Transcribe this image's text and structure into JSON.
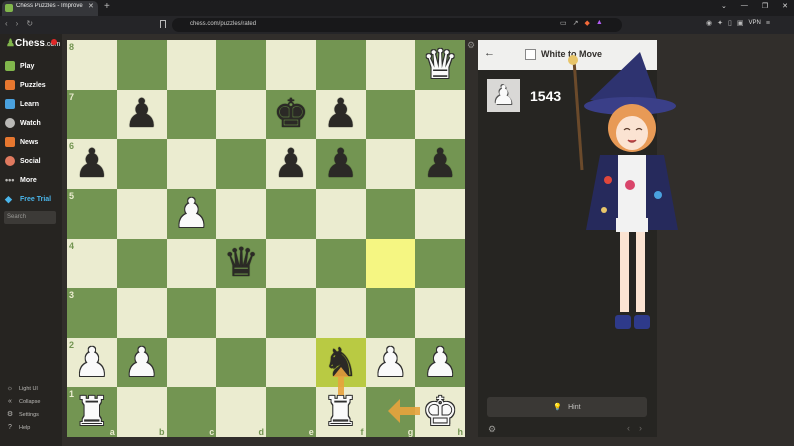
{
  "browser": {
    "tab_title": "Chess Puzzles - Improve Your C",
    "tab_close": "✕",
    "new_tab": "+",
    "url": "chess.com/puzzles/rated",
    "vpn_label": "VPN",
    "window_controls": [
      "⌄",
      "—",
      "❐",
      "✕"
    ]
  },
  "sidebar": {
    "logo": "Chess",
    "logo_suffix": ".com",
    "items": [
      {
        "label": "Play",
        "icon": "play-icon",
        "color": "#81b64c"
      },
      {
        "label": "Puzzles",
        "icon": "puzzle-icon",
        "color": "#e7772f"
      },
      {
        "label": "Learn",
        "icon": "learn-icon",
        "color": "#4aa1de"
      },
      {
        "label": "Watch",
        "icon": "watch-icon",
        "color": "#bab9b6"
      },
      {
        "label": "News",
        "icon": "news-icon",
        "color": "#e7772f"
      },
      {
        "label": "Social",
        "icon": "social-icon",
        "color": "#e07a5f"
      },
      {
        "label": "More",
        "icon": "more-icon",
        "color": "#bab9b6"
      },
      {
        "label": "Free Trial",
        "icon": "diamond-icon",
        "color": "#4ab5ea"
      }
    ],
    "search_placeholder": "Search",
    "bottom": [
      {
        "label": "Light UI",
        "icon": "sun-icon"
      },
      {
        "label": "Collapse",
        "icon": "collapse-icon"
      },
      {
        "label": "Settings",
        "icon": "gear-icon"
      },
      {
        "label": "Help",
        "icon": "help-icon"
      }
    ]
  },
  "board": {
    "ranks": [
      "8",
      "7",
      "6",
      "5",
      "4",
      "3",
      "2",
      "1"
    ],
    "files": [
      "a",
      "b",
      "c",
      "d",
      "e",
      "f",
      "g",
      "h"
    ],
    "light_color": "#ebecd0",
    "dark_color": "#739552",
    "highlighted": [
      "g4",
      "f2"
    ],
    "pieces": [
      {
        "sq": "h8",
        "piece": "queen",
        "color": "white",
        "glyph": "♛"
      },
      {
        "sq": "b7",
        "piece": "pawn",
        "color": "black",
        "glyph": "♟"
      },
      {
        "sq": "e7",
        "piece": "king",
        "color": "black",
        "glyph": "♚"
      },
      {
        "sq": "f7",
        "piece": "pawn",
        "color": "black",
        "glyph": "♟"
      },
      {
        "sq": "a6",
        "piece": "pawn",
        "color": "black",
        "glyph": "♟"
      },
      {
        "sq": "e6",
        "piece": "pawn",
        "color": "black",
        "glyph": "♟"
      },
      {
        "sq": "f6",
        "piece": "pawn",
        "color": "black",
        "glyph": "♟"
      },
      {
        "sq": "h6",
        "piece": "pawn",
        "color": "black",
        "glyph": "♟"
      },
      {
        "sq": "c5",
        "piece": "pawn",
        "color": "white",
        "glyph": "♟"
      },
      {
        "sq": "d4",
        "piece": "queen",
        "color": "black",
        "glyph": "♛"
      },
      {
        "sq": "a2",
        "piece": "pawn",
        "color": "white",
        "glyph": "♟"
      },
      {
        "sq": "b2",
        "piece": "pawn",
        "color": "white",
        "glyph": "♟"
      },
      {
        "sq": "f2",
        "piece": "knight",
        "color": "black",
        "glyph": "♞"
      },
      {
        "sq": "g2",
        "piece": "pawn",
        "color": "white",
        "glyph": "♟"
      },
      {
        "sq": "h2",
        "piece": "pawn",
        "color": "white",
        "glyph": "♟"
      },
      {
        "sq": "a1",
        "piece": "rook",
        "color": "white",
        "glyph": "♜"
      },
      {
        "sq": "f1",
        "piece": "rook",
        "color": "white",
        "glyph": "♜"
      },
      {
        "sq": "h1",
        "piece": "king",
        "color": "white",
        "glyph": "♚"
      }
    ],
    "arrow_color": "#e8a33d"
  },
  "panel": {
    "turn_label": "White to Move",
    "rating": "1543",
    "rating_piece": "♟",
    "hint_label": "Hint"
  }
}
